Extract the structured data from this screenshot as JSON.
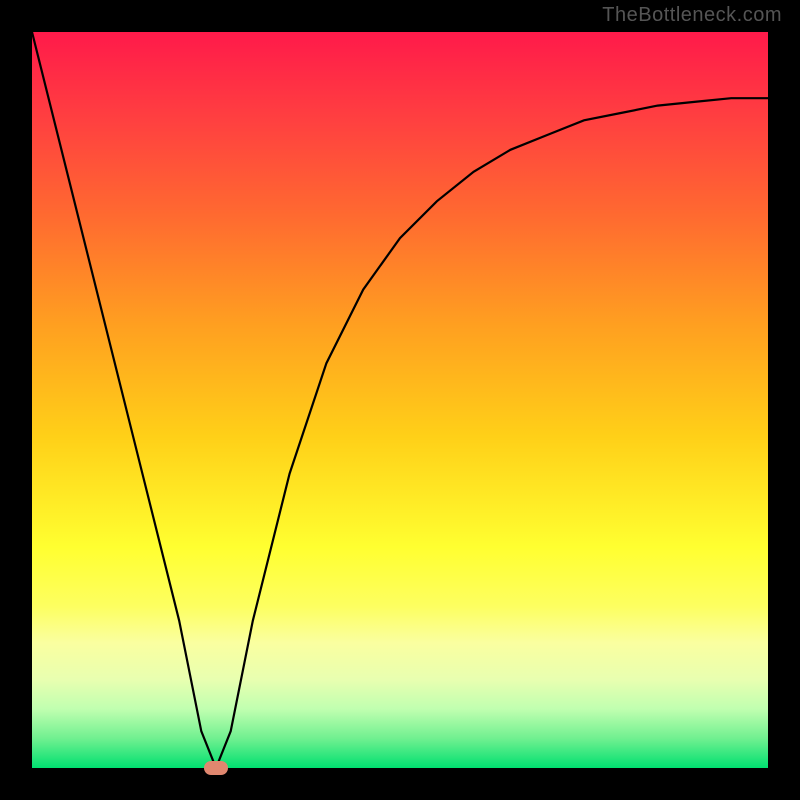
{
  "watermark": "TheBottleneck.com",
  "chart_data": {
    "type": "line",
    "title": "",
    "xlabel": "",
    "ylabel": "",
    "xlim": [
      0,
      100
    ],
    "ylim": [
      0,
      100
    ],
    "series": [
      {
        "name": "bottleneck-curve",
        "x": [
          0,
          5,
          10,
          15,
          20,
          23,
          25,
          27,
          30,
          35,
          40,
          45,
          50,
          55,
          60,
          65,
          70,
          75,
          80,
          85,
          90,
          95,
          100
        ],
        "values": [
          100,
          80,
          60,
          40,
          20,
          5,
          0,
          5,
          20,
          40,
          55,
          65,
          72,
          77,
          81,
          84,
          86,
          88,
          89,
          90,
          90.5,
          91,
          91
        ]
      }
    ],
    "annotations": [
      {
        "name": "optimal-marker",
        "x": 25,
        "y": 0
      }
    ],
    "background_gradient": {
      "top": "#ff1a4a",
      "mid": "#ffff30",
      "bottom": "#00e070"
    }
  }
}
